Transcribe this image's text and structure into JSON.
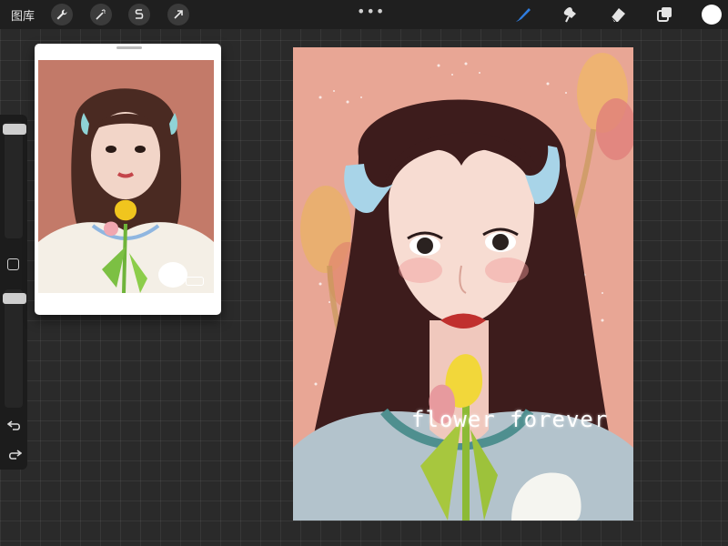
{
  "topbar": {
    "gallery_label": "图库",
    "tools_left": [
      "wrench-icon",
      "magic-wand-icon",
      "selection-icon",
      "transform-arrow-icon"
    ],
    "more_dots": "•••",
    "tools_right": [
      "brush-icon",
      "smudge-icon",
      "eraser-icon",
      "layers-icon"
    ],
    "current_color": "#ffffff"
  },
  "sidebar": {
    "controls": [
      "brush-size-slider",
      "modify-button",
      "opacity-slider",
      "undo-icon",
      "redo-icon"
    ]
  },
  "reference": {
    "window": "reference-panel"
  },
  "canvas": {
    "overlay_text": "flower forever",
    "background_color": "#e8a695"
  },
  "colors": {
    "app_bg": "#2a2a2a",
    "topbar_bg": "#1f1f1f",
    "accent_blue": "#2f7de0"
  }
}
